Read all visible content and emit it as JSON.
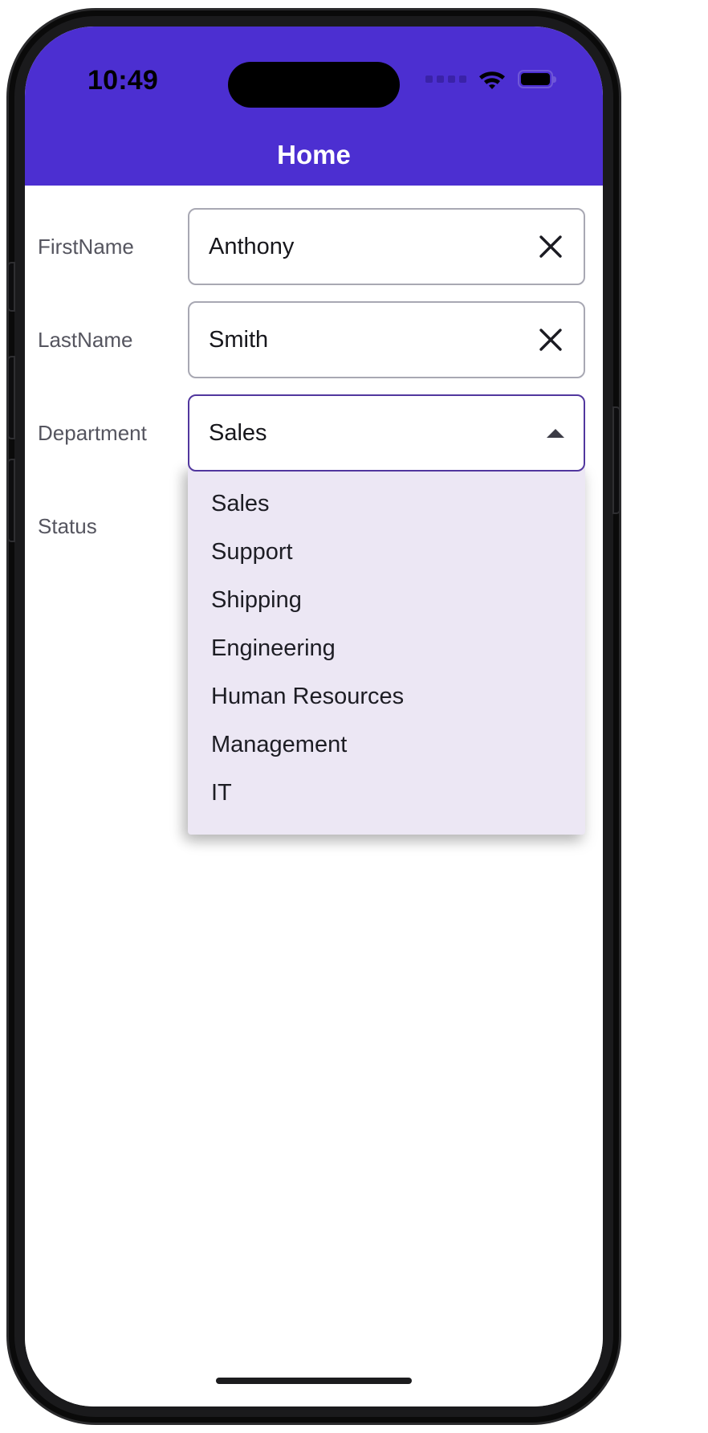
{
  "status_bar": {
    "time": "10:49",
    "signal_icon": "signal-dots-icon",
    "wifi_icon": "wifi-icon",
    "battery_icon": "battery-icon"
  },
  "header": {
    "title": "Home"
  },
  "colors": {
    "accent_purple": "#4c2fd1",
    "select_border": "#51379e",
    "dropdown_bg": "#ece7f4",
    "label_gray": "#55555f",
    "input_border": "#a8a8b3"
  },
  "form": {
    "fields": [
      {
        "label": "FirstName",
        "type": "text",
        "value": "Anthony",
        "placeholder": "",
        "clear_icon": "close-icon"
      },
      {
        "label": "LastName",
        "type": "text",
        "value": "Smith",
        "placeholder": "",
        "clear_icon": "close-icon"
      },
      {
        "label": "Department",
        "type": "select",
        "value": "Sales",
        "expanded": true,
        "caret_icon": "chevron-up-icon"
      },
      {
        "label": "Status",
        "type": "select",
        "value": ""
      }
    ]
  },
  "dropdown": {
    "open": true,
    "selected": "Sales",
    "options": [
      "Sales",
      "Support",
      "Shipping",
      "Engineering",
      "Human Resources",
      "Management",
      "IT"
    ]
  }
}
